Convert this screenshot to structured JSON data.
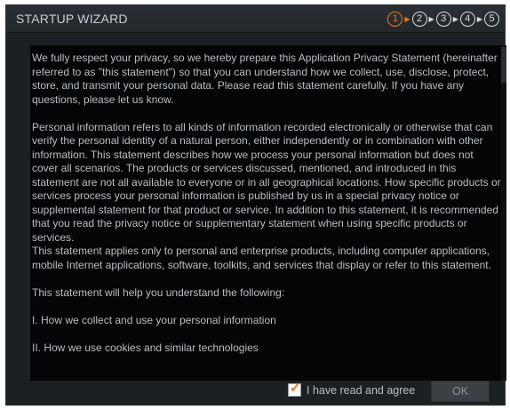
{
  "window": {
    "title": "STARTUP WIZARD"
  },
  "steps": {
    "items": [
      "1",
      "2",
      "3",
      "4",
      "5"
    ],
    "current": "1",
    "arrow": "▶"
  },
  "statement": {
    "p1": "We fully respect your privacy, so we hereby prepare this Application Privacy Statement (hereinafter referred to as \"this statement\") so that you can understand how we collect, use, disclose, protect, store, and transmit your personal data. Please read this statement carefully. If you have any questions, please let us know.",
    "p2": "Personal information refers to all kinds of information recorded electronically or otherwise that can verify the personal identity of a natural person, either independently or in combination with other information. This statement describes how we process your personal information but does not cover all scenarios. The products or services discussed, mentioned, and introduced in this statement are not all available to everyone or in all geographical locations. How specific products or services process your personal information is published by us in a special privacy notice or supplemental statement for that product or service. In addition to this statement, it is recommended that you read the privacy notice or supplementary statement when using specific products or services.",
    "p3": "This statement applies only to personal and enterprise products, including computer applications, mobile Internet applications, software, toolkits, and services that display or refer to this statement.",
    "p4": "This statement will help you understand the following:",
    "p5": "I. How we collect and use your personal information",
    "p6": "II. How we use cookies and similar technologies"
  },
  "footer": {
    "agree_label": "I have read and agree",
    "agree_checked": true,
    "checkmark": "✓",
    "ok_label": "OK"
  },
  "colors": {
    "accent": "#ee7a1c",
    "window_bg": "#1c2024",
    "content_bg": "#040506",
    "text": "#b9bec3"
  }
}
